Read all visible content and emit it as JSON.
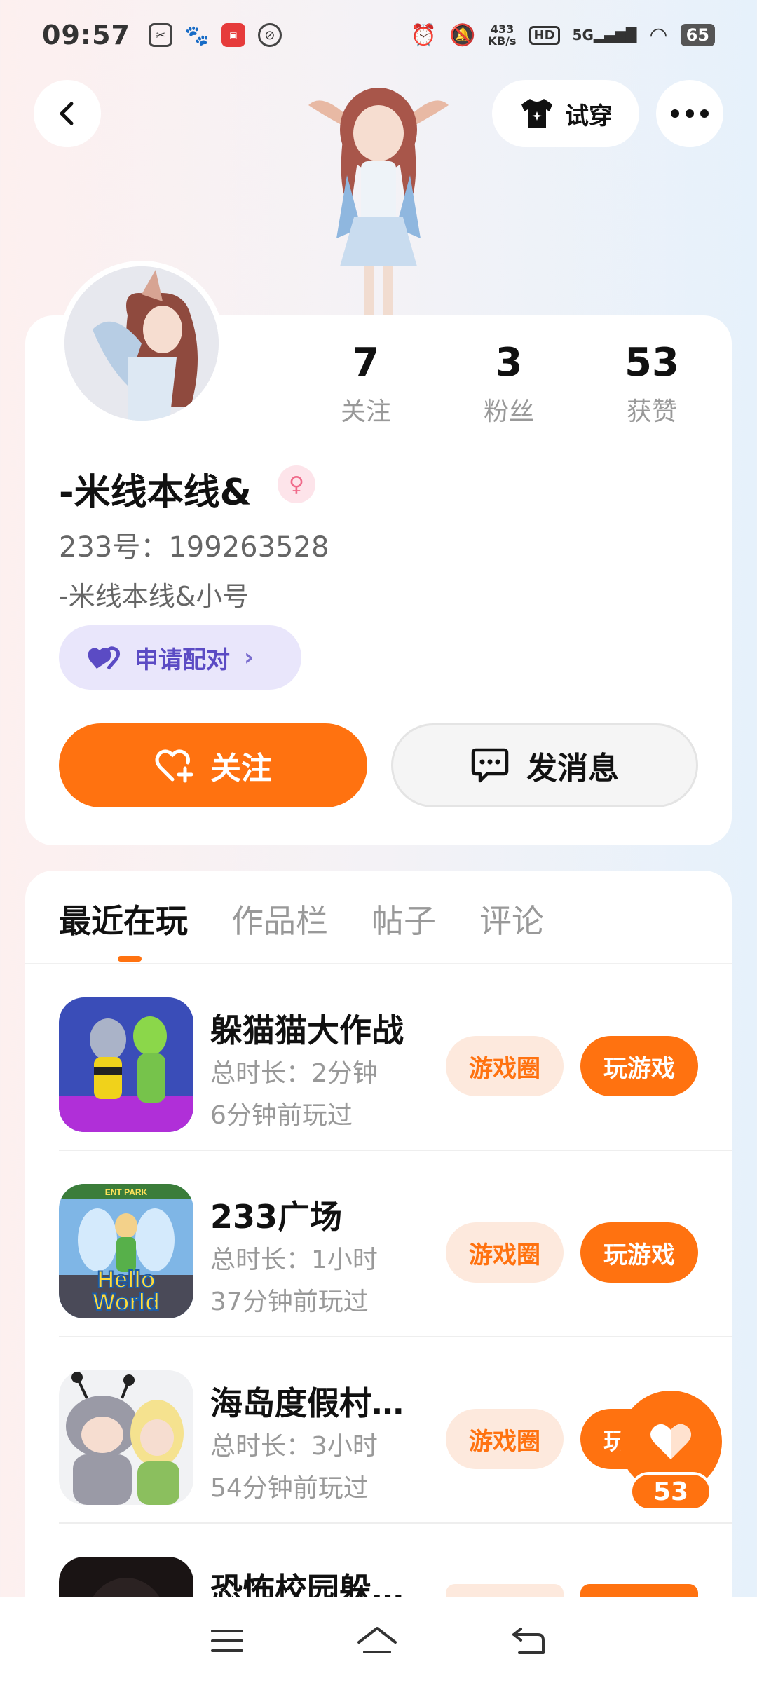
{
  "status": {
    "time": "09:57",
    "net_speed_top": "433",
    "net_speed_unit": "KB/s",
    "hd": "HD",
    "signal": "5G",
    "battery": "65"
  },
  "header": {
    "try_on_label": "试穿"
  },
  "profile": {
    "stats": [
      {
        "num": "7",
        "label": "关注"
      },
      {
        "num": "3",
        "label": "粉丝"
      },
      {
        "num": "53",
        "label": "获赞"
      }
    ],
    "name": "-米线本线&",
    "id_text": "233号：199263528",
    "bio": "-米线本线&小号",
    "pair_label": "申请配对",
    "follow_label": "关注",
    "message_label": "发消息"
  },
  "tabs": [
    "最近在玩",
    "作品栏",
    "帖子",
    "评论"
  ],
  "games": [
    {
      "name": "躲猫猫大作战",
      "duration": "总时长：2分钟",
      "last_played": "6分钟前玩过",
      "circle_label": "游戏圈",
      "play_label": "玩游戏"
    },
    {
      "name": "233广场",
      "duration": "总时长：1小时",
      "last_played": "37分钟前玩过",
      "circle_label": "游戏圈",
      "play_label": "玩游戏"
    },
    {
      "name": "海岛度假村…",
      "duration": "总时长：3小时",
      "last_played": "54分钟前玩过",
      "circle_label": "游戏圈",
      "play_label": "玩游戏"
    },
    {
      "name": "恐怖校园躲…",
      "duration": "",
      "last_played": "",
      "circle_label": "",
      "play_label": ""
    }
  ],
  "thumb_texts": {
    "hello": "Hello",
    "world": "World",
    "park": "ENT PARK"
  },
  "likes_float": {
    "count": "53"
  },
  "colors": {
    "accent": "#ff7210",
    "pair_bg": "#e9e6fb",
    "pair_text": "#5b4bc4"
  }
}
